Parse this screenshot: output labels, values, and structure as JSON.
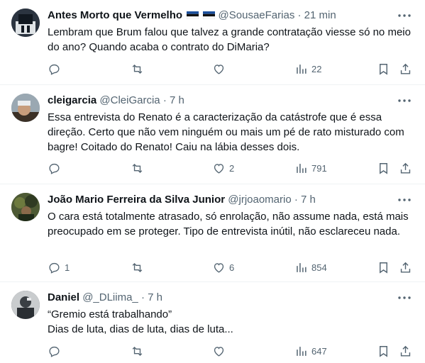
{
  "tweets": [
    {
      "name": "Antes Morto que Vermelho",
      "handle": "@SousaeFarias",
      "sep": "·",
      "time": "21 min",
      "text": [
        "Lembram que Brum falou que talvez a grande contratação viesse só no meio do ano? Quando acaba o contrato do DiMaria?"
      ],
      "replies": "",
      "retweets": "",
      "likes": "",
      "views": "22",
      "avatar_color": "#2b3440"
    },
    {
      "name": "cleigarcia",
      "handle": "@CleiGarcia",
      "sep": "·",
      "time": "7 h",
      "text": [
        "Essa entrevista do Renato é a caracterização da catástrofe que é essa direção. Certo que não vem ninguém ou mais um pé de rato misturado com bagre! Coitado do Renato! Caiu na lábia desses dois."
      ],
      "replies": "",
      "retweets": "",
      "likes": "2",
      "views": "791",
      "avatar_color": "#7a8a95"
    },
    {
      "name": "João Mario Ferreira da Silva Junior",
      "handle": "@jrjoaomario",
      "sep": "·",
      "time": "7 h",
      "text": [
        "O cara está totalmente atrasado, só enrolação, não assume nada, está mais preocupado em se proteger. Tipo de entrevista inútil, não esclareceu nada."
      ],
      "replies": "1",
      "retweets": "",
      "likes": "6",
      "views": "854",
      "avatar_color": "#3f4a2c"
    },
    {
      "name": "Daniel",
      "handle": "@_DLiima_",
      "sep": "·",
      "time": "7 h",
      "text": [
        "“Gremio está trabalhando”",
        "Dias de luta, dias de luta, dias de luta..."
      ],
      "replies": "",
      "retweets": "",
      "likes": "",
      "views": "647",
      "avatar_color": "#4a4f55"
    }
  ],
  "icons": {
    "reply": "reply-icon",
    "retweet": "retweet-icon",
    "like": "heart-icon",
    "views": "views-icon",
    "bookmark": "bookmark-icon",
    "share": "share-icon",
    "more": "more-icon",
    "flag": "flag-icon"
  },
  "colors": {
    "text": "#0f1419",
    "muted": "#536471",
    "divider": "#eff3f4",
    "flag_blue": "#1b4f9c"
  }
}
